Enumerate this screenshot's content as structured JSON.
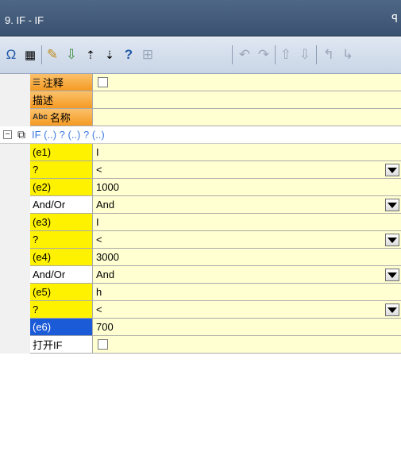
{
  "window": {
    "title": "9. IF - IF",
    "pin_glyph": "\u0007"
  },
  "toolbar": {
    "icons": [
      {
        "name": "omega-icon",
        "glyph": "Ω"
      },
      {
        "name": "calendar-icon",
        "glyph": "▦"
      },
      {
        "name": "new-icon",
        "glyph": "✎"
      },
      {
        "name": "import-icon",
        "glyph": "⇩"
      },
      {
        "name": "sort-up-icon",
        "glyph": "⇡"
      },
      {
        "name": "sort-down-icon",
        "glyph": "⇣"
      },
      {
        "name": "help-icon",
        "glyph": "?"
      },
      {
        "name": "table-icon",
        "glyph": "⊞"
      },
      {
        "name": "undo-icon",
        "glyph": "↶"
      },
      {
        "name": "redo-icon",
        "glyph": "↷"
      },
      {
        "name": "move-up-icon",
        "glyph": "⇧"
      },
      {
        "name": "move-down-icon",
        "glyph": "⇩"
      },
      {
        "name": "back-icon",
        "glyph": "↰"
      },
      {
        "name": "forward-icon",
        "glyph": "↳"
      }
    ]
  },
  "props": {
    "comment_label": "注释",
    "desc_label": "描述",
    "name_label": "名称",
    "name_icon": "Abc"
  },
  "group": {
    "text": "IF (..) ? (..) ? (..)"
  },
  "rows": [
    {
      "label": "(e1)",
      "value": "I"
    },
    {
      "label": "?",
      "value": "<"
    },
    {
      "label": "(e2)",
      "value": "1000"
    },
    {
      "label": "And/Or",
      "value": "And"
    },
    {
      "label": "(e3)",
      "value": "I"
    },
    {
      "label": "?",
      "value": "<"
    },
    {
      "label": "(e4)",
      "value": "3000"
    },
    {
      "label": "And/Or",
      "value": "And"
    },
    {
      "label": "(e5)",
      "value": "h"
    },
    {
      "label": "?",
      "value": "<"
    },
    {
      "label": "(e6)",
      "value": "700"
    }
  ],
  "footer": {
    "open_if_label": "打开IF"
  }
}
